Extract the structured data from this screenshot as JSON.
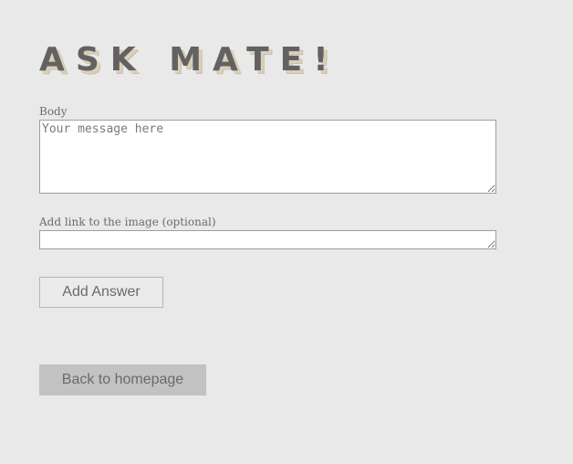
{
  "app": {
    "logo_text": "ASK MATE!"
  },
  "form": {
    "body_label": "Body",
    "body_placeholder": "Your message here",
    "image_label": "Add link to the image (optional)",
    "image_value": "",
    "submit_label": "Add Answer"
  },
  "nav": {
    "back_label": "Back to homepage"
  }
}
